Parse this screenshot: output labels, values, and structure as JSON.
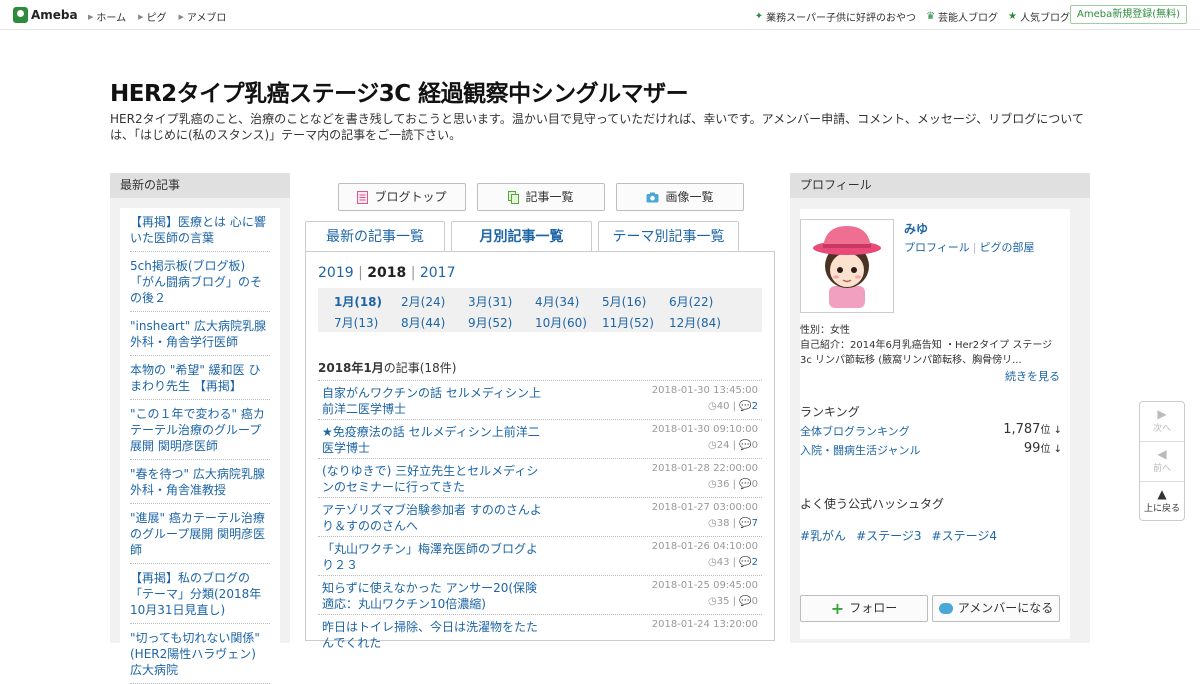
{
  "header": {
    "logo_text": "Ameba",
    "global_nav": [
      "ホーム",
      "ピグ",
      "アメブロ"
    ],
    "top_links": [
      "業務スーパー子供に好評のおやつ",
      "芸能人ブログ",
      "人気ブログ"
    ],
    "register_label": "Ameba新規登録(無料)"
  },
  "blog": {
    "title": "HER2タイプ乳癌ステージ3C 経過観察中シングルマザー",
    "description": "HER2タイプ乳癌のこと、治療のことなどを書き残しておこうと思います。温かい目で見守っていただければ、幸いです。アメンバー申請、コメント、メッセージ、リブログについては、「はじめに(私のスタンス)」テーマ内の記事をご一読下さい。"
  },
  "left_sidebar": {
    "heading": "最新の記事",
    "items": [
      "【再掲】医療とは 心に響いた医師の言葉",
      "5ch掲示板(ブログ板) 「がん闘病ブログ」のその後２",
      "\"insheart\" 広大病院乳腺外科・角舎学行医師",
      "本物の \"希望\" 緩和医 ひまわり先生 【再掲】",
      "\"この１年で変わる\" 癌カテーテル治療のグループ展開 関明彦医師",
      "\"春を待つ\" 広大病院乳腺外科・角舎准教授",
      "\"進展\" 癌カテーテル治療のグループ展開 関明彦医師",
      "【再掲】私のブログの「テーマ」分類(2018年10月31日見直し)",
      "\"切っても切れない関係\" (HER2陽性ハラヴェン) 広大病院"
    ]
  },
  "main": {
    "buttons": [
      "ブログトップ",
      "記事一覧",
      "画像一覧"
    ],
    "tabs": [
      "最新の記事一覧",
      "月別記事一覧",
      "テーマ別記事一覧"
    ],
    "active_tab": "月別記事一覧",
    "years": [
      "2019",
      "2018",
      "2017"
    ],
    "selected_year": "2018",
    "year_sep": "|",
    "months": [
      "1月(18)",
      "2月(24)",
      "3月(31)",
      "4月(34)",
      "5月(16)",
      "6月(22)",
      "7月(13)",
      "8月(44)",
      "9月(52)",
      "10月(60)",
      "11月(52)",
      "12月(84)"
    ],
    "selected_month": "1月(18)",
    "month_heading_bold": "2018年1月",
    "month_heading_rest": "の記事(18件)",
    "articles": [
      {
        "title": "自家がんワクチンの話 セルメディシン上前洋二医学博士",
        "date": "2018-01-30 13:45:00",
        "views": "40",
        "comments": "2"
      },
      {
        "title": "★免疫療法の話 セルメディシン上前洋二医学博士",
        "date": "2018-01-30 09:10:00",
        "views": "24",
        "comments": "0"
      },
      {
        "title": "(なりゆきで) 三好立先生とセルメディシンのセミナーに行ってきた",
        "date": "2018-01-28 22:00:00",
        "views": "36",
        "comments": "0"
      },
      {
        "title": "アテゾリズマブ治験参加者 すののさんより＆すののさんへ",
        "date": "2018-01-27 03:00:00",
        "views": "38",
        "comments": "7"
      },
      {
        "title": "「丸山ワクチン」梅澤充医師のブログより２３",
        "date": "2018-01-26 04:10:00",
        "views": "43",
        "comments": "2"
      },
      {
        "title": "知らずに使えなかった アンサー20(保険適応：丸山ワクチン10倍濃縮)",
        "date": "2018-01-25 09:45:00",
        "views": "35",
        "comments": "0"
      },
      {
        "title": "昨日はトイレ掃除、今日は洗濯物をたたんでくれた",
        "date": "2018-01-24 13:20:00",
        "views": "",
        "comments": ""
      }
    ]
  },
  "right_sidebar": {
    "heading": "プロフィール",
    "name": "みゆ",
    "links": [
      "プロフィール",
      "ピグの部屋"
    ],
    "gender": "性別：女性",
    "intro": "自己紹介：2014年6月乳癌告知 ・Her2タイプ ステージ3c リンパ節転移 (腋窩リンパ節転移、胸骨傍リ...",
    "more_label": "続きを見る",
    "ranking_heading": "ランキング",
    "rankings": [
      {
        "label": "全体ブログランキング",
        "value": "1,787",
        "unit": "位 ↓"
      },
      {
        "label": "入院・闘病生活ジャンル",
        "value": "99",
        "unit": "位 ↓"
      }
    ],
    "hashtag_heading": "よく使う公式ハッシュタグ",
    "hashtags": [
      "#乳がん",
      "#ステージ3",
      "#ステージ4"
    ],
    "follow_label": "フォロー",
    "amember_label": "アメンバーになる"
  },
  "pager": {
    "next": "次へ",
    "prev": "前へ",
    "top": "上に戻る"
  },
  "colors": {
    "link": "#1d65a6",
    "brand_green": "#2d8c3c",
    "sidebar_bg": "#f1f1f1",
    "sidebar_head": "#e0e0e0"
  }
}
